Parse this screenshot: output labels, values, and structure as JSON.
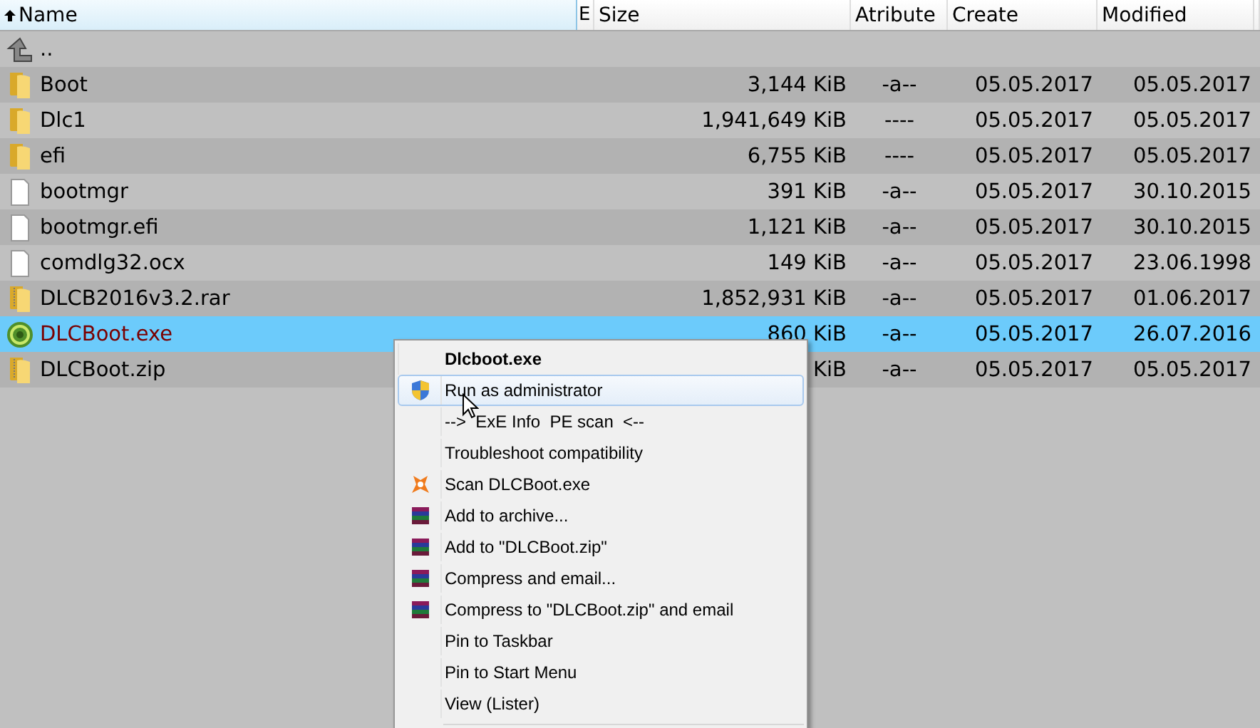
{
  "columns": [
    {
      "label": "Name",
      "sorted": true
    },
    {
      "label": "E",
      "sorted": false
    },
    {
      "label": "Size",
      "sorted": false
    },
    {
      "label": "Atribute",
      "sorted": false
    },
    {
      "label": "Create",
      "sorted": false
    },
    {
      "label": "Modified",
      "sorted": false
    }
  ],
  "rows": [
    {
      "kind": "up",
      "name": "..",
      "size": "",
      "attr": "",
      "created": "",
      "modified": "",
      "selected": false
    },
    {
      "kind": "folder",
      "name": "Boot",
      "size": "3,144 KiB",
      "attr": "-a--",
      "created": "05.05.2017",
      "modified": "05.05.2017",
      "selected": false
    },
    {
      "kind": "folder",
      "name": "Dlc1",
      "size": "1,941,649 KiB",
      "attr": "----",
      "created": "05.05.2017",
      "modified": "05.05.2017",
      "selected": false
    },
    {
      "kind": "folder",
      "name": "efi",
      "size": "6,755 KiB",
      "attr": "----",
      "created": "05.05.2017",
      "modified": "05.05.2017",
      "selected": false
    },
    {
      "kind": "file",
      "name": "bootmgr",
      "size": "391 KiB",
      "attr": "-a--",
      "created": "05.05.2017",
      "modified": "30.10.2015",
      "selected": false
    },
    {
      "kind": "file",
      "name": "bootmgr.efi",
      "size": "1,121 KiB",
      "attr": "-a--",
      "created": "05.05.2017",
      "modified": "30.10.2015",
      "selected": false
    },
    {
      "kind": "file",
      "name": "comdlg32.ocx",
      "size": "149 KiB",
      "attr": "-a--",
      "created": "05.05.2017",
      "modified": "23.06.1998",
      "selected": false
    },
    {
      "kind": "archive",
      "name": "DLCB2016v3.2.rar",
      "size": "1,852,931 KiB",
      "attr": "-a--",
      "created": "05.05.2017",
      "modified": "01.06.2017",
      "selected": false
    },
    {
      "kind": "exe",
      "name": "DLCBoot.exe",
      "size": "860 KiB",
      "attr": "-a--",
      "created": "05.05.2017",
      "modified": "26.07.2016",
      "selected": true
    },
    {
      "kind": "archive",
      "name": "DLCBoot.zip",
      "size": "KiB",
      "attr": "-a--",
      "created": "05.05.2017",
      "modified": "05.05.2017",
      "selected": false
    }
  ],
  "context_menu": {
    "title": "Dlcboot.exe",
    "items": [
      {
        "kind": "shield",
        "label": "Run as administrator",
        "selected": true
      },
      {
        "kind": "plain",
        "label": "-->  ExE Info  PE scan  <--",
        "selected": false
      },
      {
        "kind": "plain",
        "label": "Troubleshoot compatibility",
        "selected": false
      },
      {
        "kind": "antivirus",
        "label": "Scan DLCBoot.exe",
        "selected": false
      },
      {
        "kind": "archiver",
        "label": "Add to archive...",
        "selected": false
      },
      {
        "kind": "archiver",
        "label": "Add to \"DLCBoot.zip\"",
        "selected": false
      },
      {
        "kind": "archiver",
        "label": "Compress and email...",
        "selected": false
      },
      {
        "kind": "archiver",
        "label": "Compress to \"DLCBoot.zip\" and email",
        "selected": false
      },
      {
        "kind": "plain",
        "label": "Pin to Taskbar",
        "selected": false
      },
      {
        "kind": "plain",
        "label": "Pin to Start Menu",
        "selected": false
      },
      {
        "kind": "plain",
        "label": "View (Lister)",
        "selected": false
      }
    ]
  }
}
